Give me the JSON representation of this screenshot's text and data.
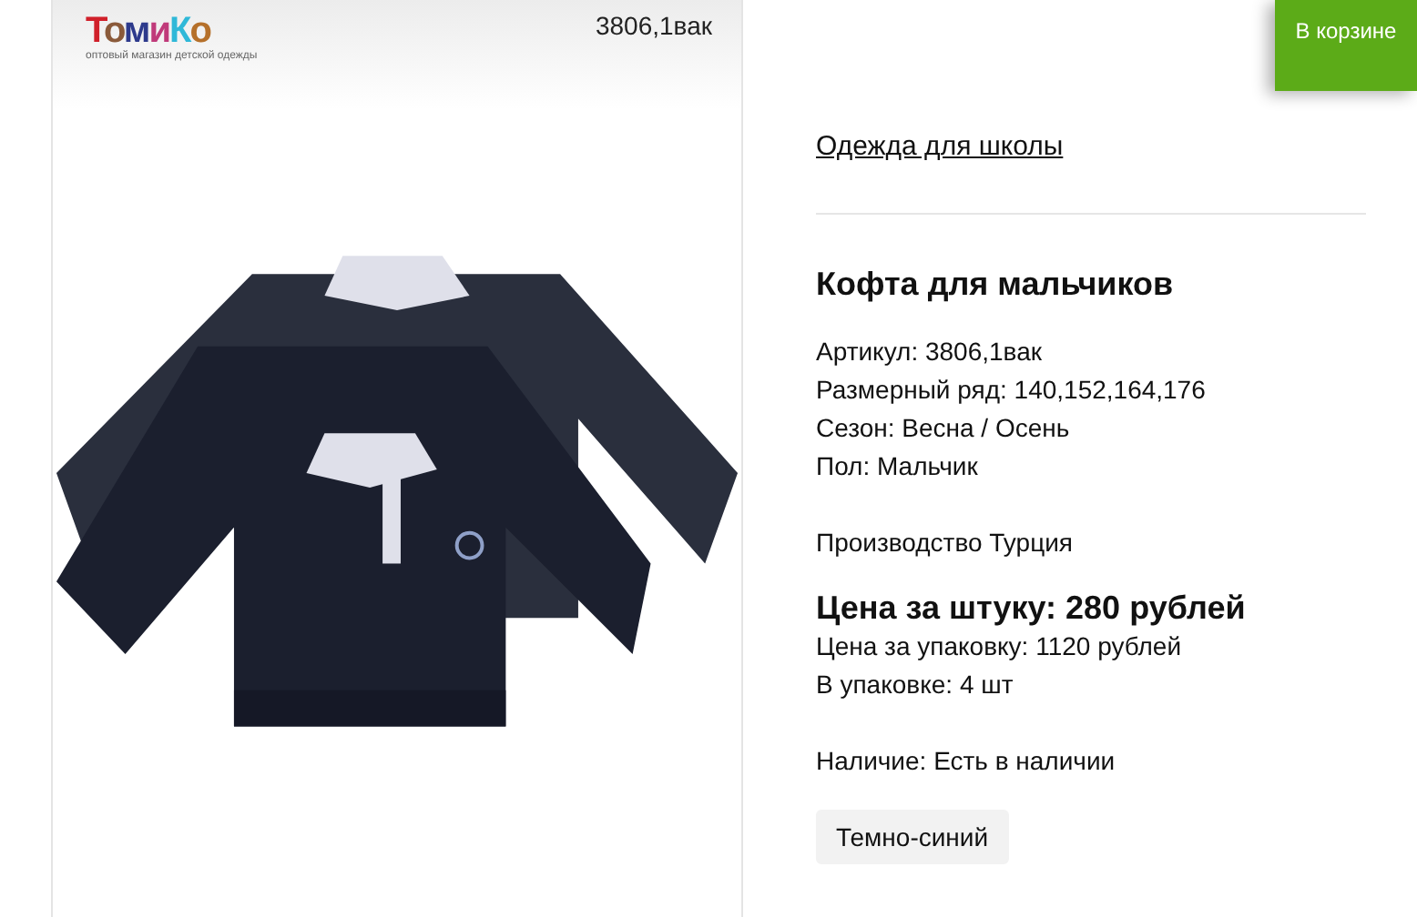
{
  "logo": {
    "text": "ТомиКо",
    "tagline": "оптовый магазин детской одежды"
  },
  "image_caption": "3806,1вак",
  "cart_button": "В корзине",
  "category_link": "Одежда для школы",
  "product": {
    "title": "Кофта для мальчиков",
    "specs": [
      "Артикул: 3806,1вак",
      "Размерный ряд: 140,152,164,176",
      "Сезон: Весна / Осень",
      "Пол: Мальчик"
    ],
    "origin": "Производство Турция",
    "price": "Цена за штуку: 280 рублей",
    "pack_price": "Цена за упаковку: 1120 рублей",
    "pack_size": "В упаковке: 4 шт",
    "availability": "Наличие: Есть в наличии",
    "colors": [
      {
        "label": "Темно-синий",
        "selected": false
      }
    ]
  }
}
